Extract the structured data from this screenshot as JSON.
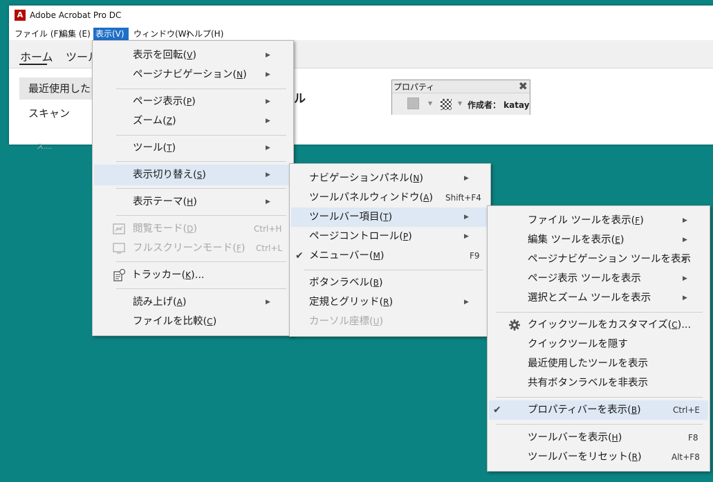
{
  "window": {
    "title": "Adobe Acrobat Pro DC",
    "app_icon": "A"
  },
  "menubar": {
    "file": "ファイル (F)",
    "edit": "編集 (E)",
    "view": "表示(V)",
    "window": "ウィンドウ(W)",
    "help": "ヘルプ(H)"
  },
  "tabs": {
    "home": "ホーム",
    "tools": "ツール"
  },
  "sidebar": {
    "recent": "最近使用した",
    "scan": "スキャン"
  },
  "main": {
    "heading_partial": "ル",
    "faded": "ス...."
  },
  "propbar": {
    "title": "プロパティ",
    "close": "✖",
    "author": "作成者： katay"
  },
  "view_menu": {
    "rotate": {
      "text": "表示を回転",
      "key": "V"
    },
    "page_nav": {
      "text": "ページナビゲーション",
      "key": "N"
    },
    "page_display": {
      "text": "ページ表示",
      "key": "P"
    },
    "zoom": {
      "text": "ズーム",
      "key": "Z"
    },
    "tools": {
      "text": "ツール",
      "key": "T"
    },
    "toggle": {
      "text": "表示切り替え",
      "key": "S"
    },
    "theme": {
      "text": "表示テーマ",
      "key": "H"
    },
    "read_mode": {
      "text": "閲覧モード",
      "key": "D",
      "shortcut": "Ctrl+H"
    },
    "fullscreen": {
      "text": "フルスクリーンモード",
      "key": "F",
      "shortcut": "Ctrl+L"
    },
    "tracker": {
      "text": "トラッカー",
      "key": "K",
      "suffix": "..."
    },
    "read_aloud": {
      "text": "読み上げ",
      "key": "A"
    },
    "compare": {
      "text": "ファイルを比較",
      "key": "C"
    }
  },
  "toggle_menu": {
    "nav_panels": {
      "text": "ナビゲーションパネル",
      "key": "N"
    },
    "tools_pane": {
      "text": "ツールパネルウィンドウ",
      "key": "A",
      "shortcut": "Shift+F4"
    },
    "toolbar_items": {
      "text": "ツールバー項目",
      "key": "T"
    },
    "page_controls": {
      "text": "ページコントロール",
      "key": "P"
    },
    "menu_bar": {
      "text": "メニューバー",
      "key": "M",
      "shortcut": "F9",
      "checked": true
    },
    "button_labels": {
      "text": "ボタンラベル",
      "key": "B"
    },
    "rulers_grids": {
      "text": "定規とグリッド",
      "key": "R"
    },
    "cursor_coords": {
      "text": "カーソル座標",
      "key": "U"
    }
  },
  "toolbar_menu": {
    "show_file": {
      "text": "ファイル ツールを表示",
      "key": "F"
    },
    "show_edit": {
      "text": "編集 ツールを表示",
      "key": "E"
    },
    "show_pagenav": {
      "text": "ページナビゲーション ツールを表示"
    },
    "show_pagedisp": {
      "text": "ページ表示 ツールを表示"
    },
    "show_selzoom": {
      "text": "選択とズーム ツールを表示"
    },
    "customize": {
      "text": "クイックツールをカスタマイズ",
      "key": "C",
      "suffix": "..."
    },
    "hide_quick": {
      "text": "クイックツールを隠す"
    },
    "show_recent": {
      "text": "最近使用したツールを表示"
    },
    "hide_share_labels": {
      "text": "共有ボタンラベルを非表示"
    },
    "show_props": {
      "text": "プロパティバーを表示",
      "key": "B",
      "shortcut": "Ctrl+E",
      "checked": true
    },
    "show_toolbars": {
      "text": "ツールバーを表示",
      "key": "H",
      "shortcut": "F8"
    },
    "reset_toolbars": {
      "text": "ツールバーをリセット",
      "key": "R",
      "shortcut": "Alt+F8"
    }
  },
  "glyphs": {
    "arrow": "▶",
    "check": "✔",
    "drop": "▼"
  },
  "colors": {
    "desktop": "#0b8382",
    "menu_highlight": "#dde8f4",
    "menubar_active": "#1e6fc7",
    "brand": "#b30b00"
  }
}
